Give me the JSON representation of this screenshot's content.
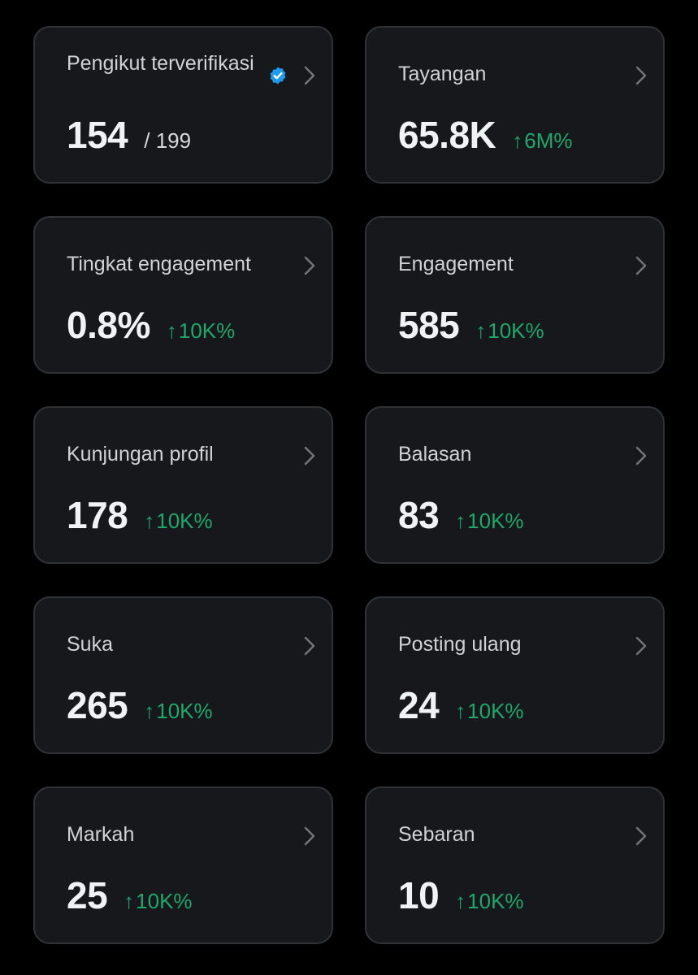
{
  "accent_color": "#1d9bf0",
  "positive_color": "#1fa86b",
  "cards": [
    {
      "label": "Pengikut terverifikasi",
      "value": "154",
      "sub": "/ 199",
      "change": "",
      "icons": [
        "verified-badge-icon",
        "chevron-right-icon"
      ]
    },
    {
      "label": "Tayangan",
      "value": "65.8K",
      "sub": "",
      "change": "6M%",
      "icons": [
        "arrow-up-icon",
        "chevron-right-icon"
      ]
    },
    {
      "label": "Tingkat engagement",
      "value": "0.8%",
      "sub": "",
      "change": "10K%",
      "icons": [
        "arrow-up-icon",
        "chevron-right-icon"
      ]
    },
    {
      "label": "Engagement",
      "value": "585",
      "sub": "",
      "change": "10K%",
      "icons": [
        "arrow-up-icon",
        "chevron-right-icon"
      ]
    },
    {
      "label": "Kunjungan profil",
      "value": "178",
      "sub": "",
      "change": "10K%",
      "icons": [
        "arrow-up-icon",
        "chevron-right-icon"
      ]
    },
    {
      "label": "Balasan",
      "value": "83",
      "sub": "",
      "change": "10K%",
      "icons": [
        "arrow-up-icon",
        "chevron-right-icon"
      ]
    },
    {
      "label": "Suka",
      "value": "265",
      "sub": "",
      "change": "10K%",
      "icons": [
        "arrow-up-icon",
        "chevron-right-icon"
      ]
    },
    {
      "label": "Posting ulang",
      "value": "24",
      "sub": "",
      "change": "10K%",
      "icons": [
        "arrow-up-icon",
        "chevron-right-icon"
      ]
    },
    {
      "label": "Markah",
      "value": "25",
      "sub": "",
      "change": "10K%",
      "icons": [
        "arrow-up-icon",
        "chevron-right-icon"
      ]
    },
    {
      "label": "Sebaran",
      "value": "10",
      "sub": "",
      "change": "10K%",
      "icons": [
        "arrow-up-icon",
        "chevron-right-icon"
      ]
    }
  ]
}
